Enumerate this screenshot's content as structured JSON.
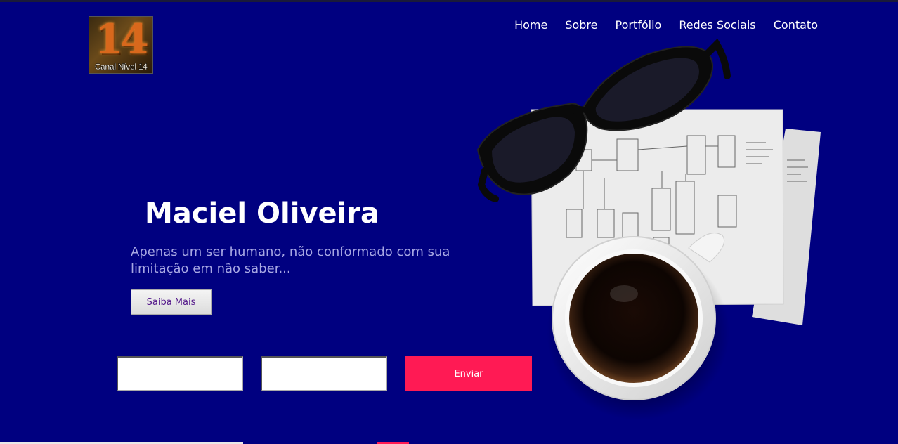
{
  "logo": {
    "number": "14",
    "caption": "Canal Nível 14"
  },
  "nav": {
    "items": [
      "Home",
      "Sobre",
      "Portfólio",
      "Redes Sociais",
      "Contato"
    ]
  },
  "hero": {
    "name": "Maciel Oliveira",
    "tagline": "Apenas um ser humano, não conformado com sua limitação em não saber...",
    "cta_label": "Saiba Mais"
  },
  "form": {
    "field1_value": "",
    "field2_value": "",
    "submit_label": "Enviar"
  },
  "colors": {
    "background": "#000080",
    "accent": "#ff1a54",
    "tagline": "#a7a7e3"
  },
  "illustration": {
    "icons": [
      "glasses-icon",
      "sketch-paper-icon",
      "coffee-cup-icon"
    ]
  }
}
